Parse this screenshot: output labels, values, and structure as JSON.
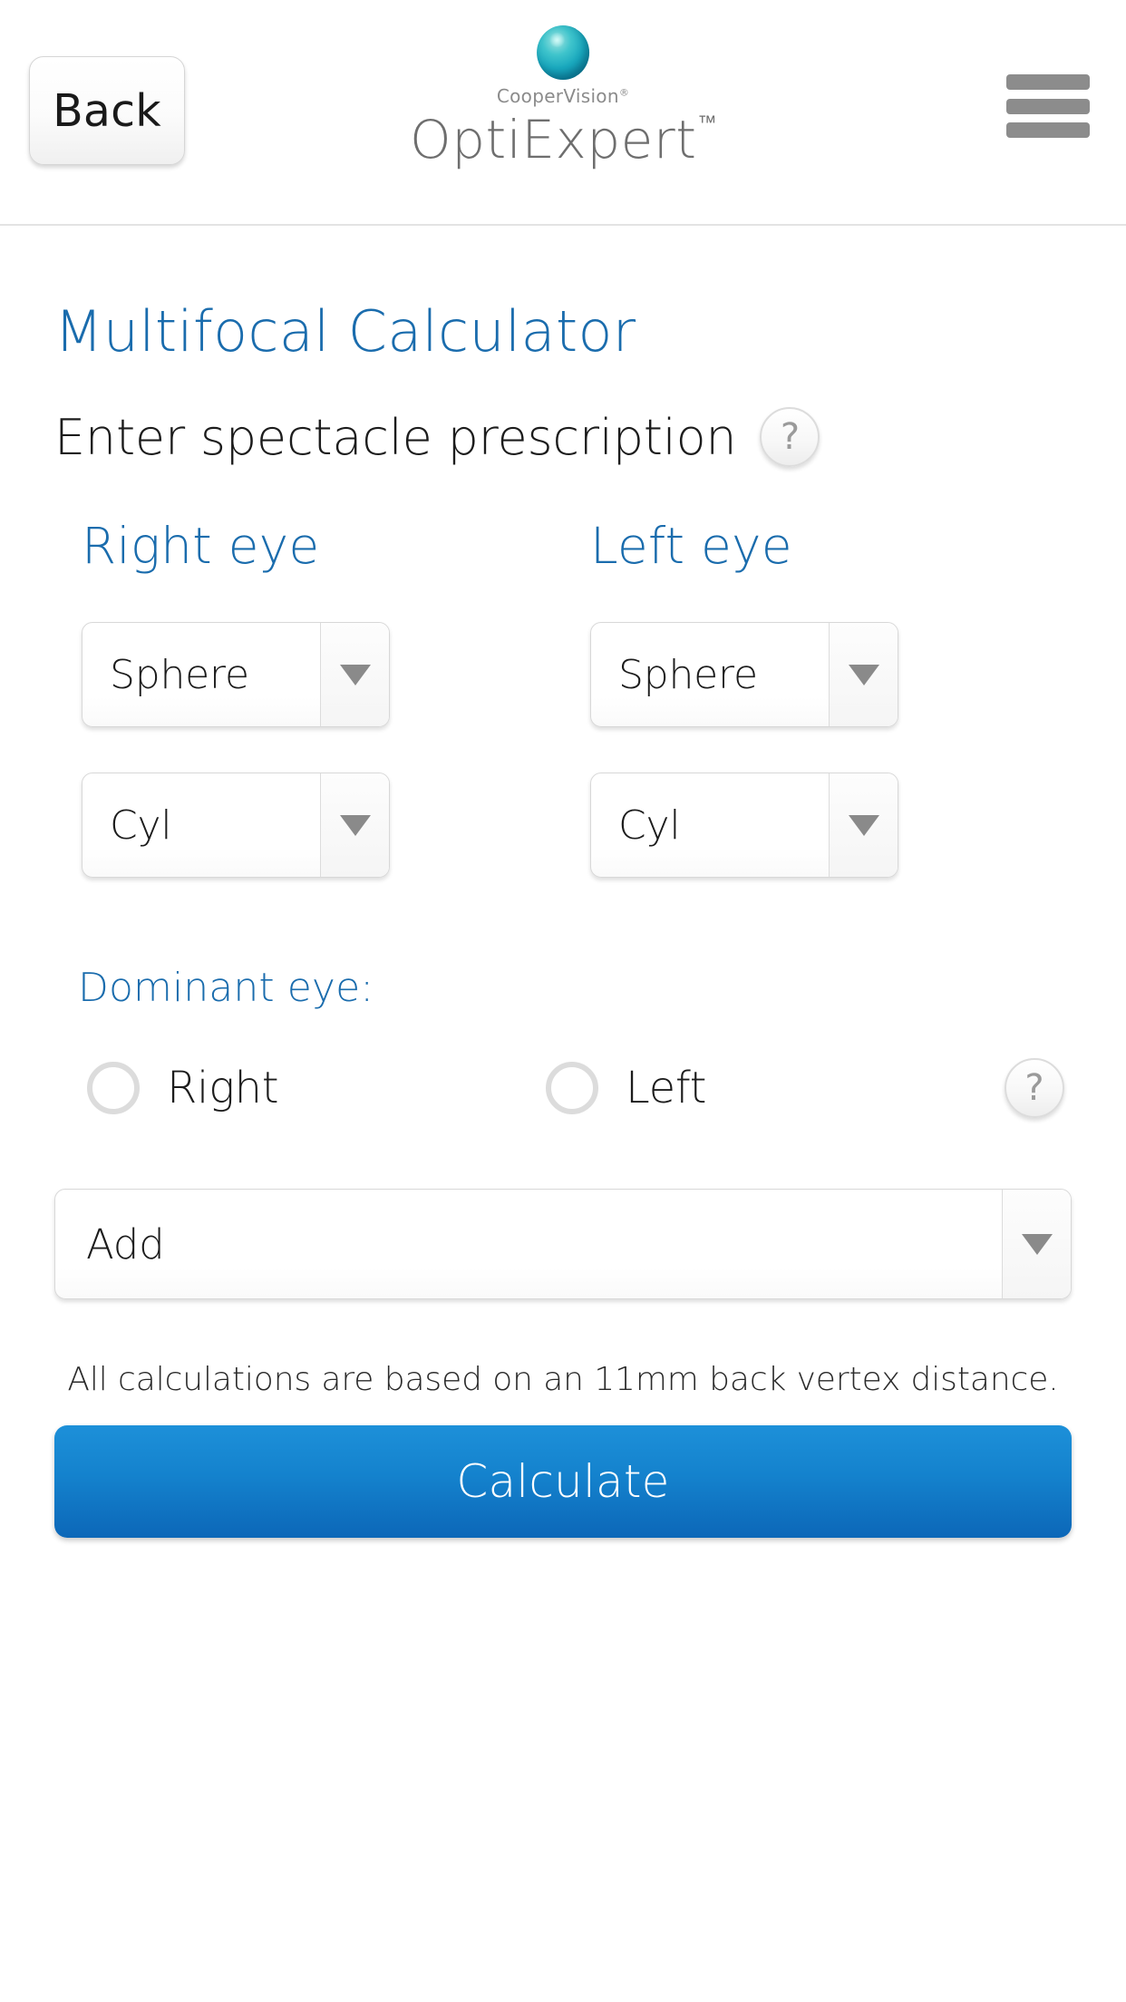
{
  "header": {
    "back_label": "Back",
    "brand_company": "CooperVision",
    "brand_company_mark": "®",
    "brand_product": "OptiExpert",
    "brand_product_mark": "™",
    "menu_icon": "hamburger-menu-icon",
    "logo_icon": "coopervision-globe-icon"
  },
  "main": {
    "page_title": "Multifocal Calculator",
    "subtitle": "Enter spectacle prescription",
    "help_icon_glyph": "?",
    "right_eye": {
      "heading": "Right eye",
      "sphere_value": "Sphere",
      "cyl_value": "Cyl"
    },
    "left_eye": {
      "heading": "Left eye",
      "sphere_value": "Sphere",
      "cyl_value": "Cyl"
    },
    "dominant_eye": {
      "label": "Dominant eye:",
      "options": [
        {
          "label": "Right",
          "selected": false
        },
        {
          "label": "Left",
          "selected": false
        }
      ],
      "help_icon_glyph": "?"
    },
    "add_value": "Add",
    "vertex_note": "All calculations are based on an 11mm back vertex distance.",
    "calculate_label": "Calculate"
  },
  "colors": {
    "accent_blue": "#1a6cad",
    "button_blue_top": "#1d90d9",
    "button_blue_bottom": "#0c67b8",
    "logo_teal": "#18a7bd",
    "text_dark": "#1c1c1c",
    "icon_gray": "#8c8c8c"
  }
}
